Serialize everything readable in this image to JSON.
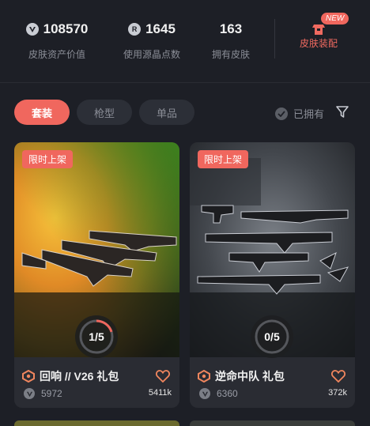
{
  "stats": {
    "asset_value": {
      "value": "108570",
      "label": "皮肤资产价值",
      "icon": "valorant-point-icon"
    },
    "radianite": {
      "value": "1645",
      "label": "使用源晶点数",
      "icon": "radianite-icon"
    },
    "owned_skins": {
      "value": "163",
      "label": "拥有皮肤"
    },
    "equip": {
      "badge": "NEW",
      "label": "皮肤装配",
      "icon": "loadout-icon"
    }
  },
  "filters": {
    "tabs": [
      "套装",
      "枪型",
      "单品"
    ],
    "active_tab": "套装",
    "owned_label": "已拥有"
  },
  "colors": {
    "accent": "#f0675e",
    "bg": "#1d1f26",
    "card": "#2a2c33"
  },
  "cards": [
    {
      "tag": "限时上架",
      "progress": "1/5",
      "progress_fraction": 0.2,
      "name": "回响 // V26 礼包",
      "price": "5972",
      "likes": "5411k"
    },
    {
      "tag": "限时上架",
      "progress": "0/5",
      "progress_fraction": 0.0,
      "name": "逆命中队 礼包",
      "price": "6360",
      "likes": "372k"
    }
  ]
}
